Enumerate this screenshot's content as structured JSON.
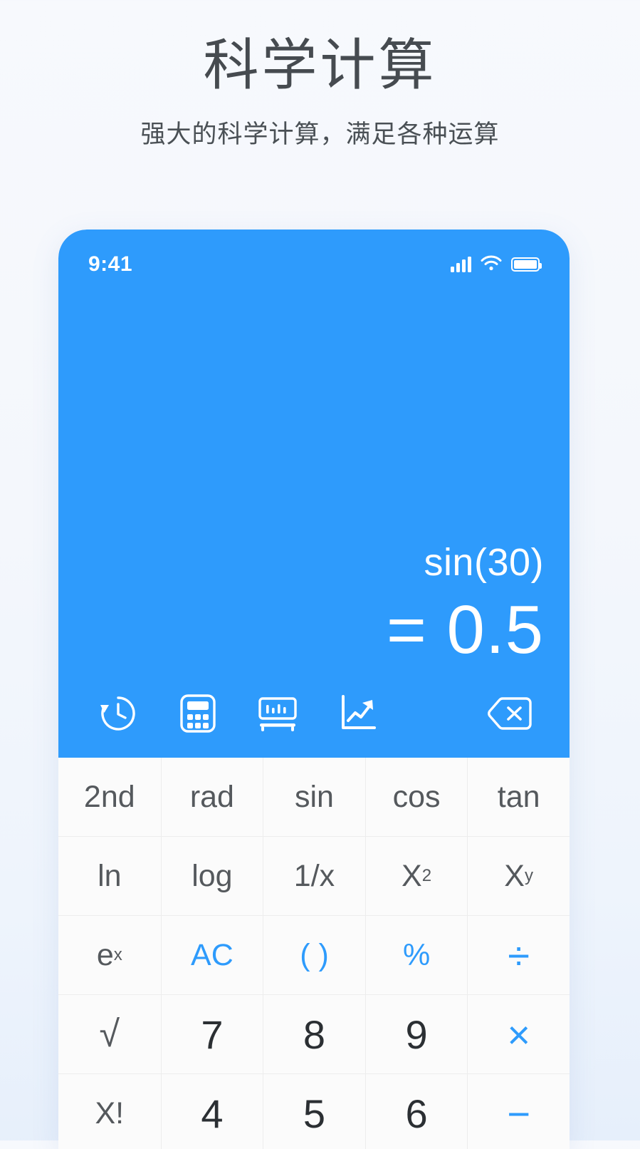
{
  "promo": {
    "title": "科学计算",
    "subtitle": "强大的科学计算，满足各种运算"
  },
  "colors": {
    "accent": "#2e9bfc",
    "page_background": "#f4f7fc",
    "key_background": "#fbfbfb",
    "key_text": "#55595d",
    "digit_text": "#2b2f33",
    "display_text": "#ffffff"
  },
  "phone": {
    "status_bar": {
      "time": "9:41",
      "signal_icon": "signal-bars-icon",
      "wifi_icon": "wifi-icon",
      "battery_icon": "battery-full-icon"
    },
    "display": {
      "expression": "sin(30)",
      "result": "= 0.5"
    },
    "toolbar": [
      {
        "name": "history-icon",
        "label": "history"
      },
      {
        "name": "calculator-icon",
        "label": "calculator"
      },
      {
        "name": "unit-converter-icon",
        "label": "unit converter"
      },
      {
        "name": "chart-trending-icon",
        "label": "chart"
      },
      {
        "name": "backspace-icon",
        "label": "backspace"
      }
    ],
    "keypad": {
      "rows": [
        [
          {
            "label": "2nd",
            "style": "func"
          },
          {
            "label": "rad",
            "style": "func"
          },
          {
            "label": "sin",
            "style": "func"
          },
          {
            "label": "cos",
            "style": "func"
          },
          {
            "label": "tan",
            "style": "func"
          }
        ],
        [
          {
            "label": "ln",
            "style": "func"
          },
          {
            "label": "log",
            "style": "func"
          },
          {
            "label": "1/x",
            "style": "func"
          },
          {
            "label": "X",
            "sup": "2",
            "style": "func"
          },
          {
            "label": "X",
            "sup": "y",
            "style": "func"
          }
        ],
        [
          {
            "label": "e",
            "sup": "x",
            "style": "func"
          },
          {
            "label": "AC",
            "style": "accent"
          },
          {
            "label": "( )",
            "style": "accent"
          },
          {
            "label": "%",
            "style": "accent"
          },
          {
            "label": "÷",
            "style": "op"
          }
        ],
        [
          {
            "label": "√",
            "style": "func"
          },
          {
            "label": "7",
            "style": "digit"
          },
          {
            "label": "8",
            "style": "digit"
          },
          {
            "label": "9",
            "style": "digit"
          },
          {
            "label": "×",
            "style": "op"
          }
        ],
        [
          {
            "label": "X!",
            "style": "func"
          },
          {
            "label": "4",
            "style": "digit"
          },
          {
            "label": "5",
            "style": "digit"
          },
          {
            "label": "6",
            "style": "digit"
          },
          {
            "label": "−",
            "style": "op"
          }
        ]
      ]
    }
  }
}
